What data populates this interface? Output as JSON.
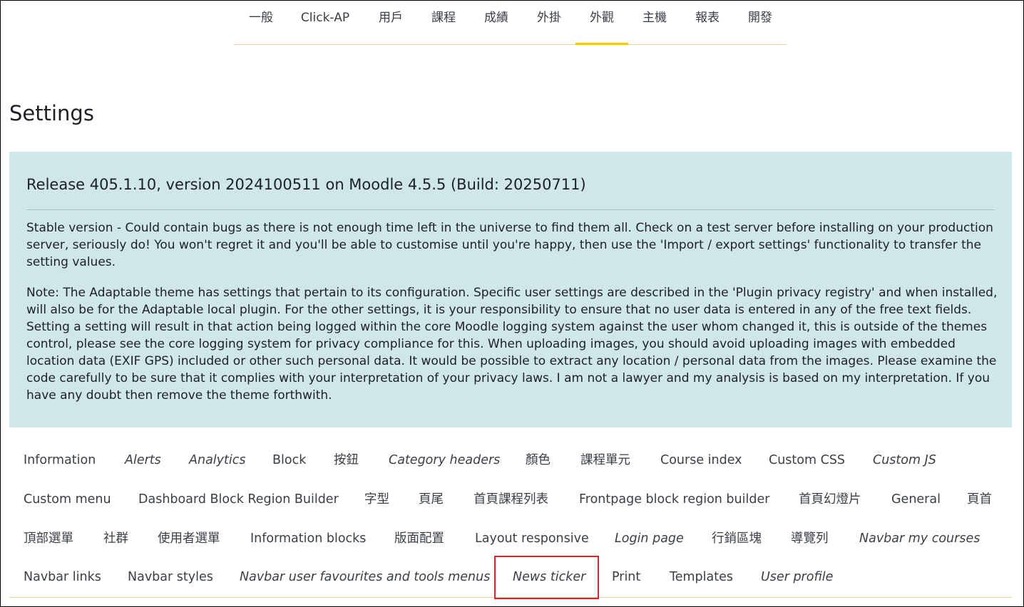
{
  "top_tabs": [
    {
      "label": "一般"
    },
    {
      "label": "Click-AP"
    },
    {
      "label": "用戶"
    },
    {
      "label": "課程"
    },
    {
      "label": "成績"
    },
    {
      "label": "外掛"
    },
    {
      "label": "外觀",
      "active": true
    },
    {
      "label": "主機"
    },
    {
      "label": "報表"
    },
    {
      "label": "開發"
    }
  ],
  "page": {
    "title": "Settings"
  },
  "info": {
    "heading": "Release 405.1.10, version 2024100511 on Moodle 4.5.5 (Build: 20250711)",
    "paragraph1": "Stable version - Could contain bugs as there is not enough time left in the universe to find them all. Check on a test server before installing on your production server, seriously do! You won't regret it and you'll be able to customise until you're happy, then use the 'Import / export settings' functionality to transfer the setting values.",
    "paragraph2": "Note: The Adaptable theme has settings that pertain to its configuration. Specific user settings are described in the 'Plugin privacy registry' and when installed, will also be for the Adaptable local plugin. For the other settings, it is your responsibility to ensure that no user data is entered in any of the free text fields. Setting a setting will result in that action being logged within the core Moodle logging system against the user whom changed it, this is outside of the themes control, please see the core logging system for privacy compliance for this. When uploading images, you should avoid uploading images with embedded location data (EXIF GPS) included or other such personal data. It would be possible to extract any location / personal data from the images. Please examine the code carefully to be sure that it complies with your interpretation of your privacy laws. I am not a lawyer and my analysis is based on my interpretation. If you have any doubt then remove the theme forthwith."
  },
  "settings_tabs": {
    "row1": [
      {
        "label": "Information",
        "italic": false
      },
      {
        "label": "Alerts",
        "italic": true
      },
      {
        "label": "Analytics",
        "italic": true
      },
      {
        "label": "Block",
        "italic": false
      },
      {
        "label": "按鈕",
        "italic": false
      },
      {
        "label": "Category headers",
        "italic": true
      },
      {
        "label": "顏色",
        "italic": false
      },
      {
        "label": "課程單元",
        "italic": false
      },
      {
        "label": "Course index",
        "italic": false
      },
      {
        "label": "Custom CSS",
        "italic": false
      },
      {
        "label": "Custom JS",
        "italic": true
      }
    ],
    "row2": [
      {
        "label": "Custom menu",
        "italic": false
      },
      {
        "label": "Dashboard Block Region Builder",
        "italic": false
      },
      {
        "label": "字型",
        "italic": false
      },
      {
        "label": "頁尾",
        "italic": false
      },
      {
        "label": "首頁課程列表",
        "italic": false
      },
      {
        "label": "Frontpage block region builder",
        "italic": false
      },
      {
        "label": "首頁幻燈片",
        "italic": false
      },
      {
        "label": "General",
        "italic": false
      },
      {
        "label": "頁首",
        "italic": false
      }
    ],
    "row3": [
      {
        "label": "頂部選單",
        "italic": false
      },
      {
        "label": "社群",
        "italic": false
      },
      {
        "label": "使用者選單",
        "italic": false
      },
      {
        "label": "Information blocks",
        "italic": false
      },
      {
        "label": "版面配置",
        "italic": false
      },
      {
        "label": "Layout responsive",
        "italic": false
      },
      {
        "label": "Login page",
        "italic": true
      },
      {
        "label": "行銷區塊",
        "italic": false
      },
      {
        "label": "導覽列",
        "italic": false
      },
      {
        "label": "Navbar my courses",
        "italic": true
      }
    ],
    "row4": [
      {
        "label": "Navbar links",
        "italic": false
      },
      {
        "label": "Navbar styles",
        "italic": false
      },
      {
        "label": "Navbar user favourites and tools menus",
        "italic": true
      },
      {
        "label": "News ticker",
        "italic": true
      },
      {
        "label": "Print",
        "italic": false
      },
      {
        "label": "Templates",
        "italic": false
      },
      {
        "label": "User profile",
        "italic": true
      }
    ]
  },
  "colors": {
    "info_background": "#cfe6ea",
    "active_tab_underline": "#f5c518",
    "highlight_border": "#d9262b"
  }
}
